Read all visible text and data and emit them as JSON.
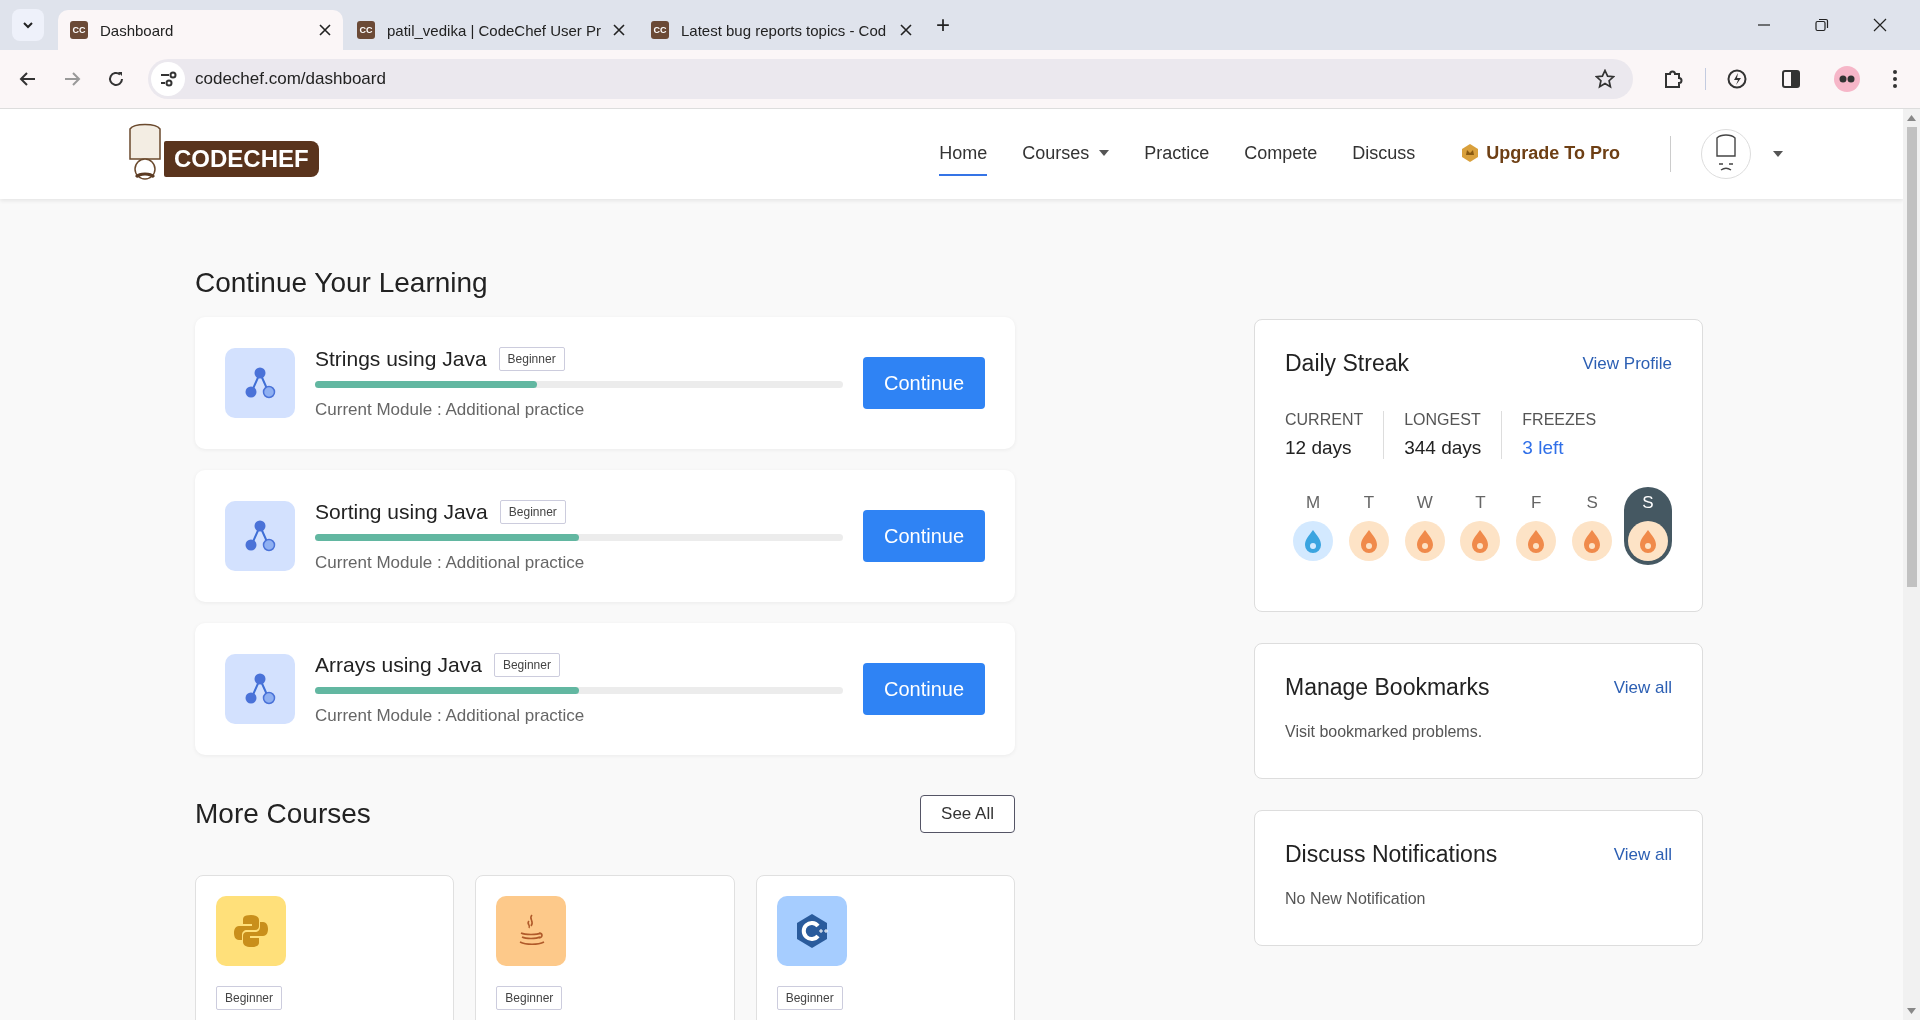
{
  "browser": {
    "tabs": [
      {
        "title": "Dashboard",
        "favicon": "CC",
        "selected": true
      },
      {
        "title": "patil_vedika | CodeChef User Pr",
        "favicon": "CC",
        "selected": false
      },
      {
        "title": "Latest bug reports topics - Cod",
        "favicon": "CC",
        "selected": false
      }
    ],
    "new_tab": "+",
    "url": "codechef.com/dashboard"
  },
  "header": {
    "logo": "CODECHEF",
    "nav": [
      {
        "label": "Home",
        "kind": "link",
        "selected": true
      },
      {
        "label": "Courses",
        "kind": "dropdown",
        "selected": false
      },
      {
        "label": "Practice",
        "kind": "link",
        "selected": false
      },
      {
        "label": "Compete",
        "kind": "link",
        "selected": false
      },
      {
        "label": "Discuss",
        "kind": "link",
        "selected": false
      },
      {
        "label": "Upgrade To Pro",
        "kind": "pro",
        "selected": false
      }
    ]
  },
  "learning": {
    "title": "Continue Your Learning",
    "courses": [
      {
        "name": "Strings using Java",
        "badge": "Beginner",
        "level": 0.42,
        "module": "Current Module : Additional practice",
        "button": "Continue"
      },
      {
        "name": "Sorting using Java",
        "badge": "Beginner",
        "level": 0.5,
        "module": "Current Module : Additional practice",
        "button": "Continue"
      },
      {
        "name": "Arrays using Java",
        "badge": "Beginner",
        "level": 0.5,
        "module": "Current Module : Additional practice",
        "button": "Continue"
      }
    ]
  },
  "more_courses": {
    "title": "More Courses",
    "button": "See All",
    "cards": [
      {
        "kind": "python",
        "badge": "Beginner"
      },
      {
        "kind": "java",
        "badge": "Beginner"
      },
      {
        "kind": "cpp",
        "badge": "Beginner"
      }
    ]
  },
  "streak": {
    "title": "Daily Streak",
    "link": "View Profile",
    "stats": [
      {
        "label": "CURRENT",
        "value": "12 days",
        "kind": "plain"
      },
      {
        "label": "LONGEST",
        "value": "344 days",
        "kind": "plain"
      },
      {
        "label": "FREEZES",
        "value": "3 left",
        "kind": "link"
      }
    ],
    "days": [
      {
        "letter": "M",
        "kind": "freeze",
        "selected": false
      },
      {
        "letter": "T",
        "kind": "fire",
        "selected": false
      },
      {
        "letter": "W",
        "kind": "fire",
        "selected": false
      },
      {
        "letter": "T",
        "kind": "fire",
        "selected": false
      },
      {
        "letter": "F",
        "kind": "fire",
        "selected": false
      },
      {
        "letter": "S",
        "kind": "fire",
        "selected": false
      },
      {
        "letter": "S",
        "kind": "fire",
        "selected": true
      }
    ]
  },
  "bookmarks": {
    "title": "Manage Bookmarks",
    "link": "View all",
    "text": "Visit bookmarked problems."
  },
  "notifications": {
    "title": "Discuss Notifications",
    "link": "View all",
    "text": "No New Notification"
  }
}
